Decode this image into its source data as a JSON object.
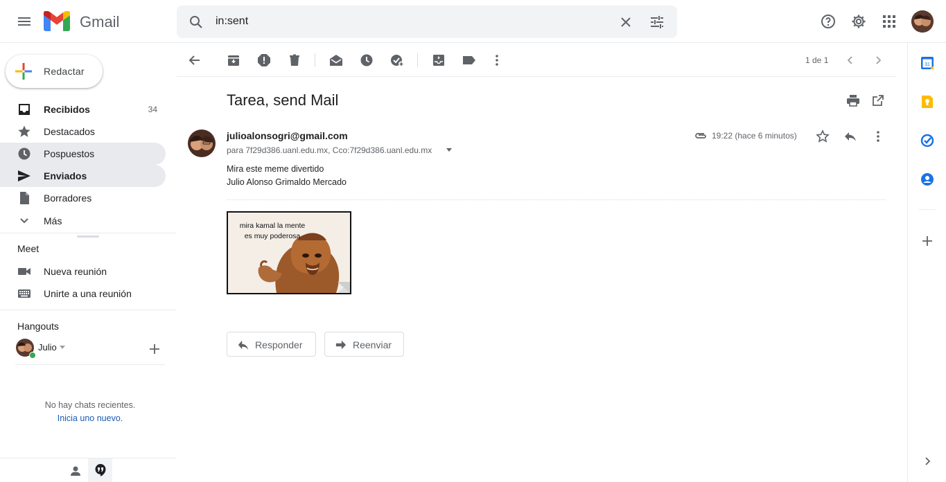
{
  "header": {
    "app_name": "Gmail",
    "search_value": "in:sent"
  },
  "nav": {
    "compose_label": "Redactar",
    "items": [
      {
        "label": "Recibidos",
        "count": "34"
      },
      {
        "label": "Destacados",
        "count": ""
      },
      {
        "label": "Pospuestos",
        "count": ""
      },
      {
        "label": "Enviados",
        "count": ""
      },
      {
        "label": "Borradores",
        "count": ""
      },
      {
        "label": "Más",
        "count": ""
      }
    ],
    "meet": {
      "title": "Meet",
      "items": [
        "Nueva reunión",
        "Unirte a una reunión"
      ]
    },
    "hangouts": {
      "title": "Hangouts",
      "user": "Julio",
      "empty_text": "No hay chats recientes.",
      "start_link": "Inicia uno nuevo."
    }
  },
  "toolbar": {
    "pagination": "1 de 1"
  },
  "message": {
    "subject": "Tarea, send Mail",
    "sender": "julioalonsogri@gmail.com",
    "recipients": "para 7f29d386.uanl.edu.mx, Cco:7f29d386.uanl.edu.mx",
    "time": "19:22 (hace 6 minutos)",
    "body_lines": [
      "Mira este meme divertido",
      "Julio Alonso Grimaldo Mercado"
    ],
    "attachment_caption": [
      "mira kamal la mente",
      "es muy poderosa"
    ]
  },
  "actions": {
    "reply": "Responder",
    "forward": "Reenviar"
  },
  "colors": {
    "accent_red": "#ea4335",
    "accent_blue": "#1a73e8",
    "selected_bg": "#e8eaed",
    "presence_green": "#34a853"
  },
  "icons": [
    "menu-icon",
    "gmail-logo",
    "search-icon",
    "clear-icon",
    "search-options-icon",
    "help-icon",
    "settings-icon",
    "apps-icon",
    "back-icon",
    "archive-icon",
    "spam-icon",
    "delete-icon",
    "mark-unread-icon",
    "snooze-icon",
    "add-task-icon",
    "move-to-icon",
    "label-icon",
    "more-icon",
    "chevron-left-icon",
    "chevron-right-icon",
    "print-icon",
    "open-new-window-icon",
    "attachment-icon",
    "star-icon",
    "reply-icon",
    "forward-icon",
    "calendar-icon",
    "keep-icon",
    "tasks-icon",
    "contacts-icon",
    "plus-icon"
  ]
}
